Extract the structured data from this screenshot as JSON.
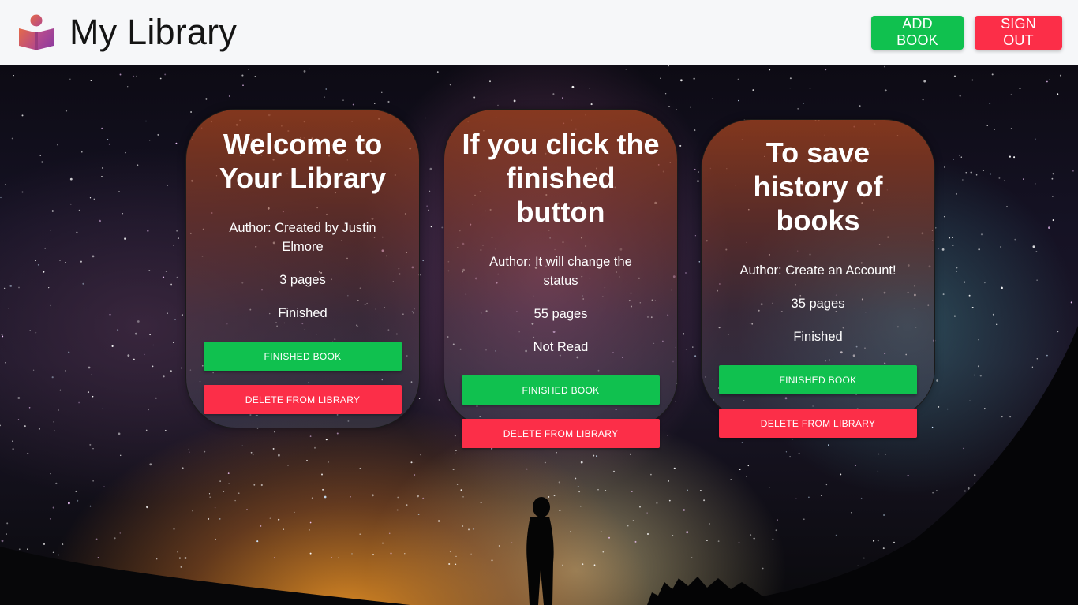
{
  "header": {
    "title": "My Library",
    "add_book_label": "ADD BOOK",
    "sign_out_label": "SIGN OUT",
    "logo_icon": "book-reader-icon"
  },
  "cards": [
    {
      "title": "Welcome to Your Library",
      "author": "Author: Created by Justin Elmore",
      "pages": "3 pages",
      "status": "Finished",
      "finished_label": "FINISHED BOOK",
      "delete_label": "DELETE FROM LIBRARY"
    },
    {
      "title": "If you click the finished button",
      "author": "Author: It will change the status",
      "pages": "55 pages",
      "status": "Not Read",
      "finished_label": "FINISHED BOOK",
      "delete_label": "DELETE FROM LIBRARY"
    },
    {
      "title": "To save history of books",
      "author": "Author: Create an Account!",
      "pages": "35 pages",
      "status": "Finished",
      "finished_label": "FINISHED BOOK",
      "delete_label": "DELETE FROM LIBRARY"
    }
  ],
  "colors": {
    "green": "#10c14f",
    "red": "#fc2e48",
    "header_bg": "#f6f7f9"
  }
}
